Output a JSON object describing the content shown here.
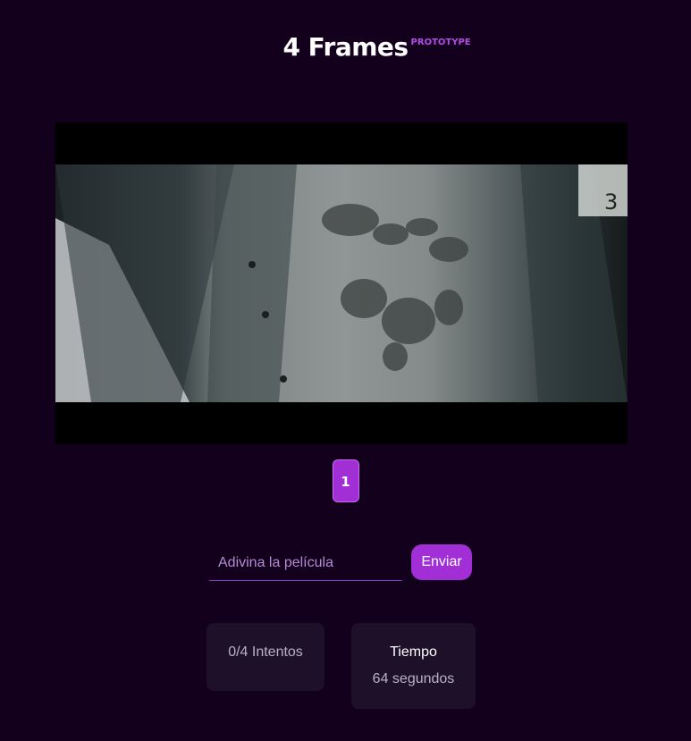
{
  "header": {
    "title": "4 Frames",
    "badge": "PROTOTYPE"
  },
  "frame_tabs": [
    {
      "label": "1",
      "active": true
    }
  ],
  "guess": {
    "placeholder": "Adivina la película",
    "value": "",
    "submit_label": "Enviar"
  },
  "stats": {
    "attempts": "0/4 Intentos",
    "time_label": "Tiempo",
    "time_value": "64 segundos"
  },
  "colors": {
    "background": "#12001c",
    "accent": "#a22fd6",
    "card": "#1e1029",
    "badge": "#b44de8"
  }
}
